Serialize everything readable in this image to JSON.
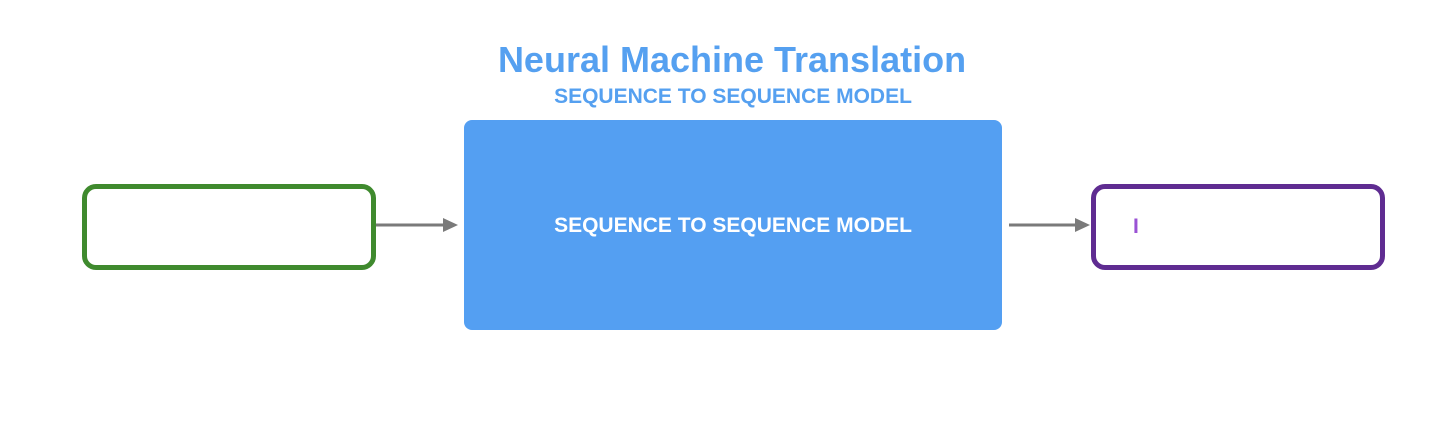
{
  "title": "Neural Machine Translation",
  "subtitle": "SEQUENCE TO SEQUENCE MODEL",
  "model_box": {
    "label": "SEQUENCE TO SEQUENCE MODEL",
    "color": "#549ff2"
  },
  "input_box": {
    "text": "",
    "border_color": "#3f8a2e"
  },
  "output_box": {
    "text": "I",
    "border_color": "#5f2c91",
    "text_color": "#9a52d4"
  },
  "arrow_color": "#7a7a7a"
}
